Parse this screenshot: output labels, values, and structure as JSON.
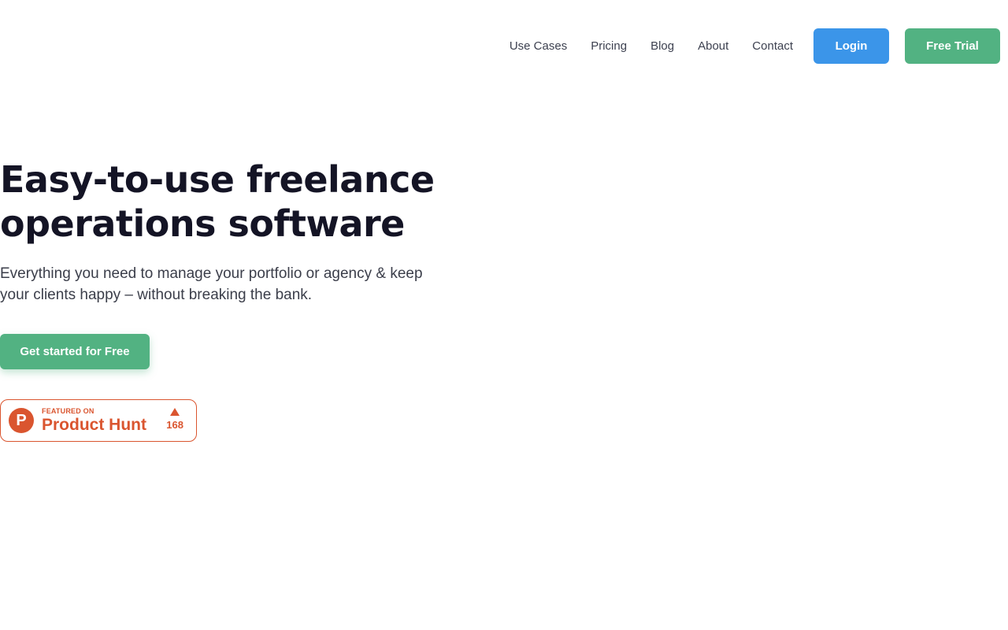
{
  "nav": {
    "links": [
      "Use Cases",
      "Pricing",
      "Blog",
      "About",
      "Contact"
    ],
    "login_label": "Login",
    "trial_label": "Free Trial"
  },
  "hero": {
    "title_line1": "Easy-to-use freelance",
    "title_line2": "operations software",
    "subtitle_line1": "Everything you need to manage your portfolio or agency & keep",
    "subtitle_line2": "your clients happy – without breaking the bank.",
    "cta_label": "Get started for Free"
  },
  "product_hunt": {
    "logo_letter": "P",
    "featured_label": "FEATURED ON",
    "name": "Product Hunt",
    "votes": "168",
    "color": "#da552f"
  },
  "colors": {
    "login": "#3b95e9",
    "trial": "#52b282",
    "cta": "#52b282"
  }
}
